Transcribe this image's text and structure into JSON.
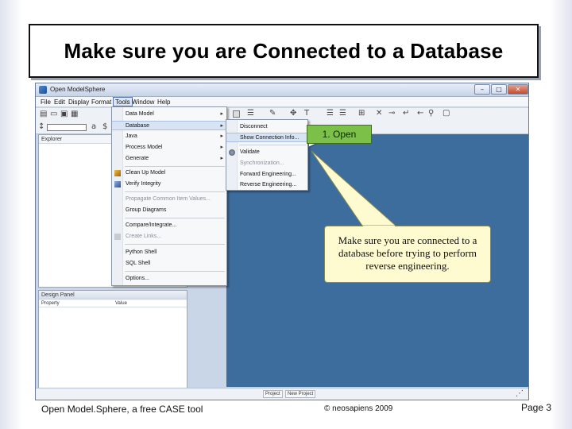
{
  "slide": {
    "title": "Make sure you are Connected to a Database",
    "footer_left": "Open Model.Sphere, a free CASE tool",
    "footer_mid": "© neosapiens 2009",
    "footer_right": "Page 3"
  },
  "window": {
    "title": "Open ModelSphere",
    "minimize": "–",
    "maximize": "□",
    "close": "✕"
  },
  "menubar": {
    "items": [
      "File",
      "Edit",
      "Display",
      "Format",
      "Tools",
      "Window",
      "Help"
    ]
  },
  "panels": {
    "explorer": "Explorer",
    "design_panel": "Design Panel",
    "property_col": "Property",
    "value_col": "Value"
  },
  "tools_menu": {
    "items": [
      {
        "label": "Data Model",
        "submenu": true
      },
      {
        "label": "Database",
        "submenu": true,
        "highlighted": true
      },
      {
        "label": "Java",
        "submenu": true
      },
      {
        "label": "Process Model",
        "submenu": true
      },
      {
        "label": "Generate",
        "submenu": true
      },
      {
        "label": "Clean Up Model"
      },
      {
        "label": "Verify Integrity"
      },
      {
        "label": "Propagate Common Item Values...",
        "disabled": true
      },
      {
        "label": "Group Diagrams"
      },
      {
        "label": "Compare/Integrate..."
      },
      {
        "label": "Create Links...",
        "disabled": true
      },
      {
        "label": "Python Shell"
      },
      {
        "label": "SQL Shell"
      },
      {
        "label": "Options..."
      }
    ]
  },
  "database_submenu": {
    "items": [
      {
        "label": "Disconnect"
      },
      {
        "label": "Show Connection Info...",
        "highlighted": true
      },
      {
        "label": "Validate"
      },
      {
        "label": "Synchronization...",
        "disabled": true
      },
      {
        "label": "Forward Engineering..."
      },
      {
        "label": "Reverse Engineering..."
      }
    ]
  },
  "statusbar": {
    "project": "Project",
    "project_name": "New Project"
  },
  "callouts": {
    "step": "1. Open",
    "note": "Make sure you are connected to a database before trying to perform reverse engineering."
  },
  "colors": {
    "workspace": "#3d6d9c",
    "step_tag": "#7cc04a",
    "note_bg": "#fffbd0"
  }
}
